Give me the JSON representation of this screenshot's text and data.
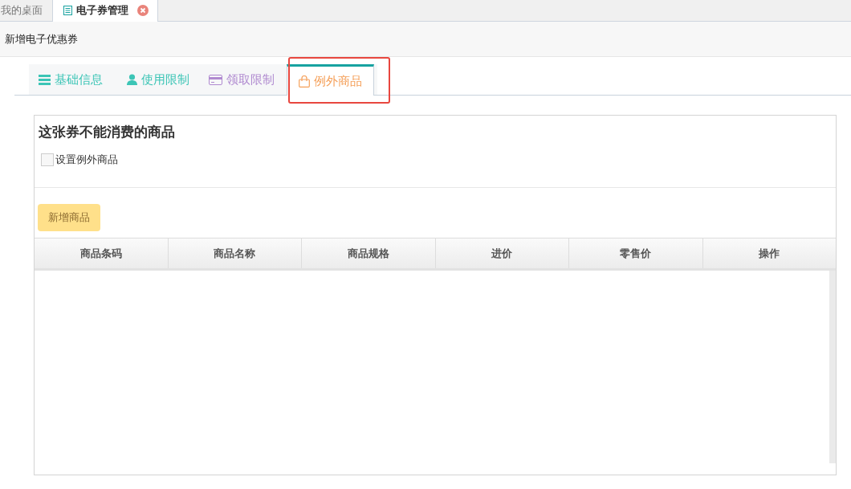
{
  "page_tabs": [
    {
      "label": "我的桌面",
      "selected": false,
      "closable": false
    },
    {
      "label": "电子券管理",
      "selected": true,
      "closable": true
    }
  ],
  "breadcrumb": "新增电子优惠券",
  "form_tabs": [
    {
      "label": "基础信息",
      "kind": "list",
      "selected": false,
      "color": "#3cc5b6"
    },
    {
      "label": "使用限制",
      "kind": "user",
      "selected": false,
      "color": "#3cc5b6"
    },
    {
      "label": "领取限制",
      "kind": "card",
      "selected": false,
      "color": "#b08ad0"
    },
    {
      "label": "例外商品",
      "kind": "bag",
      "selected": true,
      "color": "#f5a05a"
    }
  ],
  "section": {
    "title": "这张券不能消费的商品",
    "checkbox": {
      "label": "设置例外商品",
      "checked": false
    },
    "add_button": "新增商品"
  },
  "table": {
    "columns": [
      "商品条码",
      "商品名称",
      "商品规格",
      "进价",
      "零售价",
      "操作"
    ]
  }
}
